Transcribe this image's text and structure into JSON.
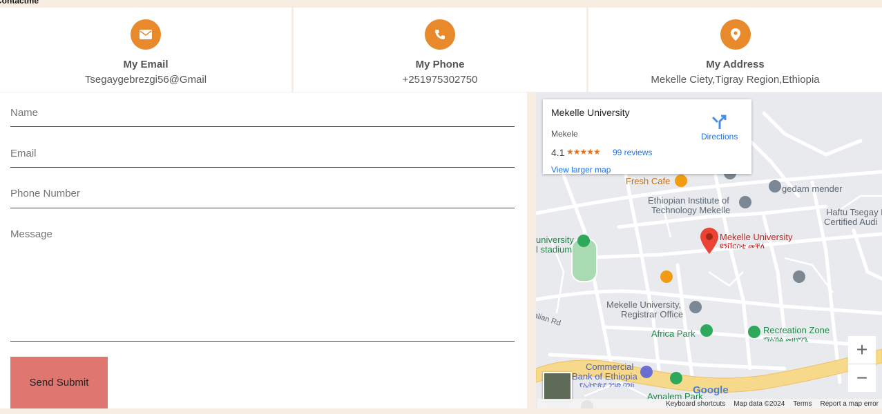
{
  "page": {
    "label": "Contactme"
  },
  "cards": [
    {
      "title": "My Email",
      "value": "Tsegaygebrezgi56@Gmail",
      "icon": "envelope-icon"
    },
    {
      "title": "My Phone",
      "value": "+251975302750",
      "icon": "phone-icon"
    },
    {
      "title": "My Address",
      "value": "Mekelle Ciety,Tigray Region,Ethiopia",
      "icon": "map-pin-icon"
    }
  ],
  "form": {
    "name_placeholder": "Name",
    "email_placeholder": "Email",
    "phone_placeholder": "Phone Number",
    "message_placeholder": "Message",
    "submit_label": "Send Submit"
  },
  "map": {
    "info": {
      "name": "Mekelle University",
      "city": "Mekele",
      "rating": "4.1",
      "stars": "★★★★★",
      "reviews": "99 reviews",
      "view_larger": "View larger map",
      "directions": "Directions"
    },
    "places": {
      "fresh_cafe": "Fresh Cafe",
      "gedam_mender": "gedam mender",
      "eit_line1": "Ethiopian Institute of",
      "eit_line2": "Technology Mekelle",
      "haftu_line1": "Haftu Tsegay K",
      "haftu_line2": "Certified Audi",
      "stadium_line1": "university",
      "stadium_line2": "l stadium",
      "mu_name": "Mekelle University",
      "mu_local": "ዩንቨርስቲ መቐለ",
      "registrar_line1": "Mekelle University,",
      "registrar_line2": "Registrar Office",
      "africa_park": "Africa Park",
      "recreation": "Recreation Zone",
      "recreation_local": "ማእኸል መዘናግዒ",
      "cbe_line1": "Commercial",
      "cbe_line2": "Bank of Ethiopia",
      "cbe_local": "የኢትዮጵያ ንግድ ባንክ",
      "aynalem": "Aynalem Park",
      "road": "alian Rd"
    },
    "zoom_in": "+",
    "zoom_out": "−",
    "google": "Google",
    "footer": {
      "shortcuts": "Keyboard shortcuts",
      "map_data": "Map data ©2024",
      "terms": "Terms",
      "report": "Report a map error"
    }
  },
  "colors": {
    "accent": "#e8892b",
    "submit": "#df7770",
    "background": "#f8ede2",
    "link": "#1a73e8"
  }
}
